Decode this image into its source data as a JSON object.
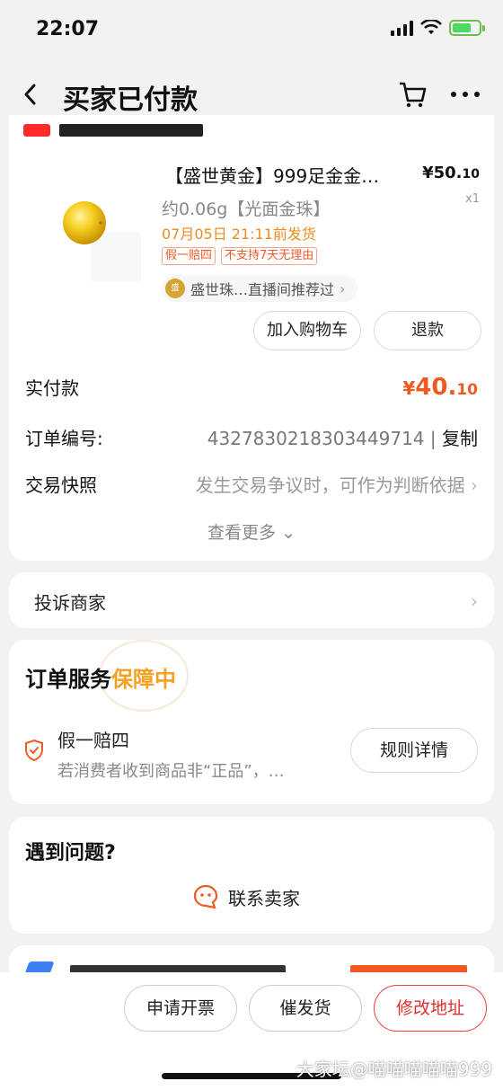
{
  "status_bar": {
    "time": "22:07"
  },
  "nav": {
    "title": "买家已付款"
  },
  "product": {
    "title": "【盛世黄金】999足金金…",
    "price_symbol": "¥",
    "price_int": "50.",
    "price_dec": "10",
    "qty": "x1",
    "spec": "约0.06g【光面金珠】",
    "ship_time": "07月05日 21:11前发货",
    "tags": [
      "假一赔四",
      "不支持7天无理由"
    ],
    "live_text": "盛世珠…直播间推荐过",
    "add_cart_label": "加入购物车",
    "refund_label": "退款"
  },
  "order": {
    "paid_label": "实付款",
    "paid_symbol": "¥",
    "paid_int": "40.",
    "paid_dec": "10",
    "order_no_label": "订单编号:",
    "order_no_value": "4327830218303449714",
    "copy_label": "复制",
    "snapshot_label": "交易快照",
    "snapshot_value": "发生交易争议时，可作为判断依据",
    "see_more": "查看更多"
  },
  "complaint": {
    "label": "投诉商家"
  },
  "service": {
    "title_prefix": "订单服务",
    "title_highlight": "保障中",
    "item_name": "假一赔四",
    "item_desc": "若消费者收到商品非“正品”，…",
    "rules_label": "规则详情"
  },
  "help": {
    "title": "遇到问题?",
    "contact_label": "联系卖家"
  },
  "bottom_bar": {
    "invoice": "申请开票",
    "urge": "催发货",
    "address": "修改地址"
  },
  "watermark": "大家坛@喵喵喵喵喵999",
  "colors": {
    "accent": "#f05a22",
    "gold": "#f5a020",
    "ship": "#ee8a1f"
  }
}
